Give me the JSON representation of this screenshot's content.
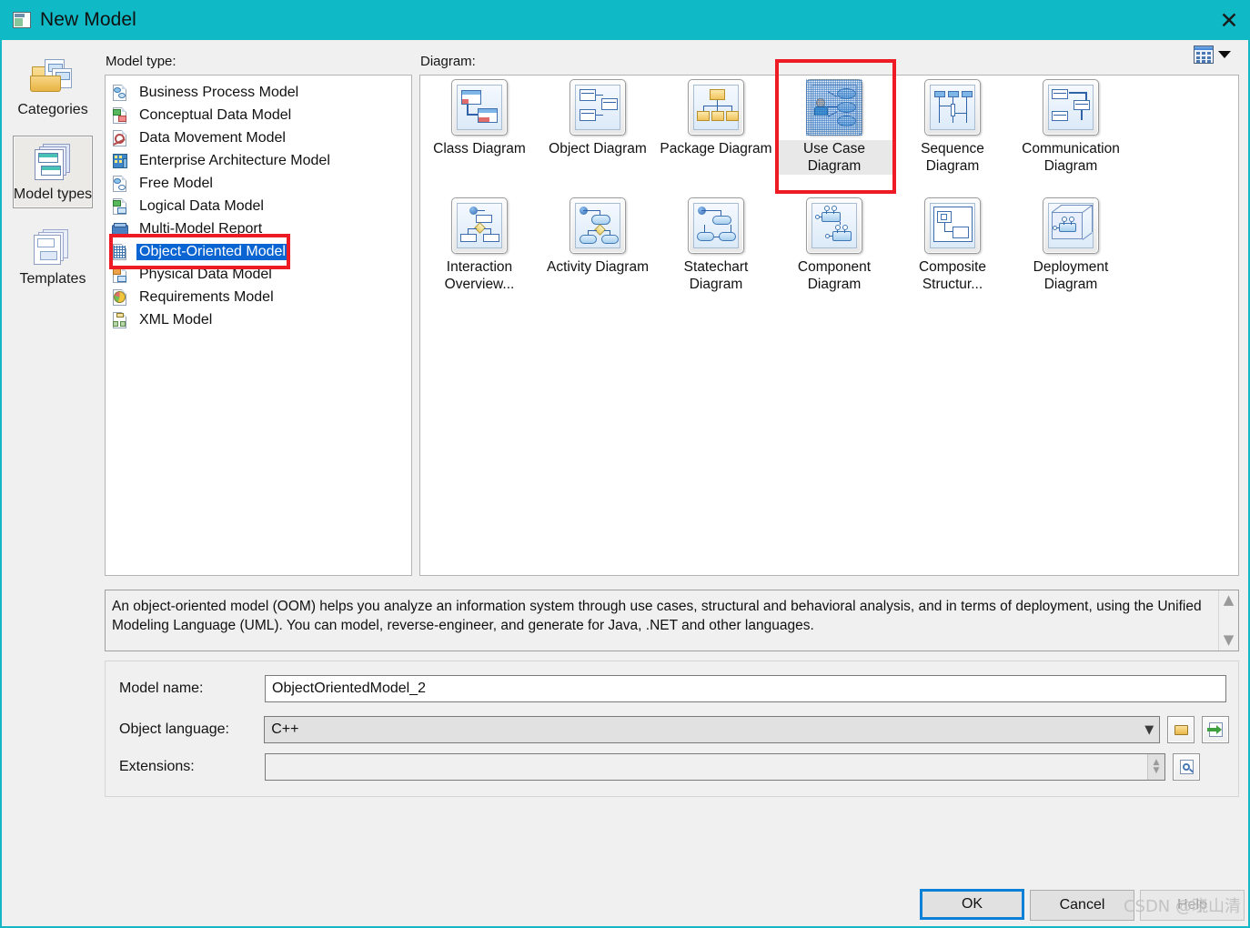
{
  "window": {
    "title": "New Model",
    "title_icon": "model-window-icon",
    "close_icon": "close-icon",
    "accent_color": "#0fbac6",
    "background_color": "#f0f0f0"
  },
  "rail": {
    "items": [
      {
        "label": "Categories",
        "icon": "folder-documents-icon",
        "selected": false
      },
      {
        "label": "Model types",
        "icon": "stacked-windows-icon",
        "selected": true
      },
      {
        "label": "Templates",
        "icon": "stacked-templates-icon",
        "selected": false
      }
    ]
  },
  "model_type": {
    "section_label": "Model type:",
    "items": [
      {
        "label": "Business Process Model",
        "icon": "business-process-icon",
        "selected": false
      },
      {
        "label": "Conceptual Data Model",
        "icon": "conceptual-data-icon",
        "selected": false
      },
      {
        "label": "Data Movement Model",
        "icon": "data-movement-icon",
        "selected": false
      },
      {
        "label": "Enterprise Architecture Model",
        "icon": "enterprise-architecture-icon",
        "selected": false
      },
      {
        "label": "Free Model",
        "icon": "free-model-icon",
        "selected": false
      },
      {
        "label": "Logical Data Model",
        "icon": "logical-data-icon",
        "selected": false
      },
      {
        "label": "Multi-Model Report",
        "icon": "multi-model-report-icon",
        "selected": false
      },
      {
        "label": "Object-Oriented Model",
        "icon": "object-oriented-icon",
        "selected": true
      },
      {
        "label": "Physical Data Model",
        "icon": "physical-data-icon",
        "selected": false
      },
      {
        "label": "Requirements Model",
        "icon": "requirements-icon",
        "selected": false
      },
      {
        "label": "XML Model",
        "icon": "xml-model-icon",
        "selected": false
      }
    ]
  },
  "diagram": {
    "section_label": "Diagram:",
    "view_toggle": {
      "icon": "grid-view-icon",
      "caret": "chevron-down-icon"
    },
    "items": [
      {
        "label": "Class Diagram",
        "icon": "class-diagram-icon",
        "selected": false
      },
      {
        "label": "Object Diagram",
        "icon": "object-diagram-icon",
        "selected": false
      },
      {
        "label": "Package Diagram",
        "icon": "package-diagram-icon",
        "selected": false
      },
      {
        "label": "Use Case Diagram",
        "icon": "use-case-diagram-icon",
        "selected": true
      },
      {
        "label": "Sequence Diagram",
        "icon": "sequence-diagram-icon",
        "selected": false
      },
      {
        "label": "Communication Diagram",
        "icon": "communication-diagram-icon",
        "selected": false
      },
      {
        "label": "Interaction Overview...",
        "icon": "interaction-overview-icon",
        "selected": false
      },
      {
        "label": "Activity Diagram",
        "icon": "activity-diagram-icon",
        "selected": false
      },
      {
        "label": "Statechart Diagram",
        "icon": "statechart-diagram-icon",
        "selected": false
      },
      {
        "label": "Component Diagram",
        "icon": "component-diagram-icon",
        "selected": false
      },
      {
        "label": "Composite Structur...",
        "icon": "composite-structure-icon",
        "selected": false
      },
      {
        "label": "Deployment Diagram",
        "icon": "deployment-diagram-icon",
        "selected": false
      }
    ]
  },
  "description": {
    "text": "An object-oriented model (OOM) helps you analyze an information system through use cases, structural and behavioral analysis, and in terms of deployment, using the Unified Modeling Language (UML). You can model, reverse-engineer, and generate for Java, .NET and other languages.",
    "scroll_up_icon": "chevron-up-icon",
    "scroll_down_icon": "chevron-down-icon"
  },
  "form": {
    "model_name": {
      "label": "Model name:",
      "value": "ObjectOrientedModel_2",
      "placeholder": ""
    },
    "object_language": {
      "label": "Object language:",
      "value": "C++",
      "caret_icon": "chevron-down-icon",
      "buttons": [
        {
          "icon": "folder-open-icon",
          "name": "browse-object-language-button"
        },
        {
          "icon": "import-file-icon",
          "name": "import-object-language-button"
        }
      ]
    },
    "extensions": {
      "label": "Extensions:",
      "value": "",
      "placeholder": "",
      "spinner_up_icon": "chevron-up-icon",
      "spinner_down_icon": "chevron-down-icon",
      "buttons": [
        {
          "icon": "preview-extensions-icon",
          "name": "preview-extensions-button"
        }
      ]
    }
  },
  "footer": {
    "ok_label": "OK",
    "cancel_label": "Cancel",
    "help_label": "Help"
  },
  "annotations": {
    "highlight_color": "#ef1b24",
    "boxes": [
      {
        "name": "highlight-object-oriented-model"
      },
      {
        "name": "highlight-use-case-diagram"
      }
    ]
  },
  "watermark": {
    "text": "CSDN @晓山清"
  }
}
